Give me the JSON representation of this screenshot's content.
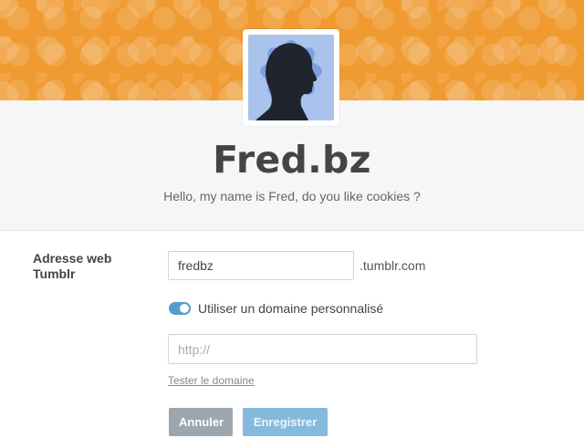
{
  "header": {
    "blog_title": "Fred.bz",
    "description": "Hello, my name is Fred, do you like cookies ?",
    "banner_color": "#ef9b31"
  },
  "form": {
    "url_label": "Adresse web Tumblr",
    "username_value": "fredbz",
    "domain_suffix": ".tumblr.com",
    "custom_domain_toggle": {
      "label": "Utiliser un domaine personnalisé",
      "on": true
    },
    "custom_domain_placeholder": "http://",
    "test_link": "Tester le domaine",
    "cancel_label": "Annuler",
    "save_label": "Enregistrer"
  },
  "colors": {
    "accent": "#529ecc",
    "cancel_button": "#9da6ae",
    "save_button_disabled": "#86b9de"
  },
  "icons": {
    "avatar": "silhouette-avatar"
  }
}
